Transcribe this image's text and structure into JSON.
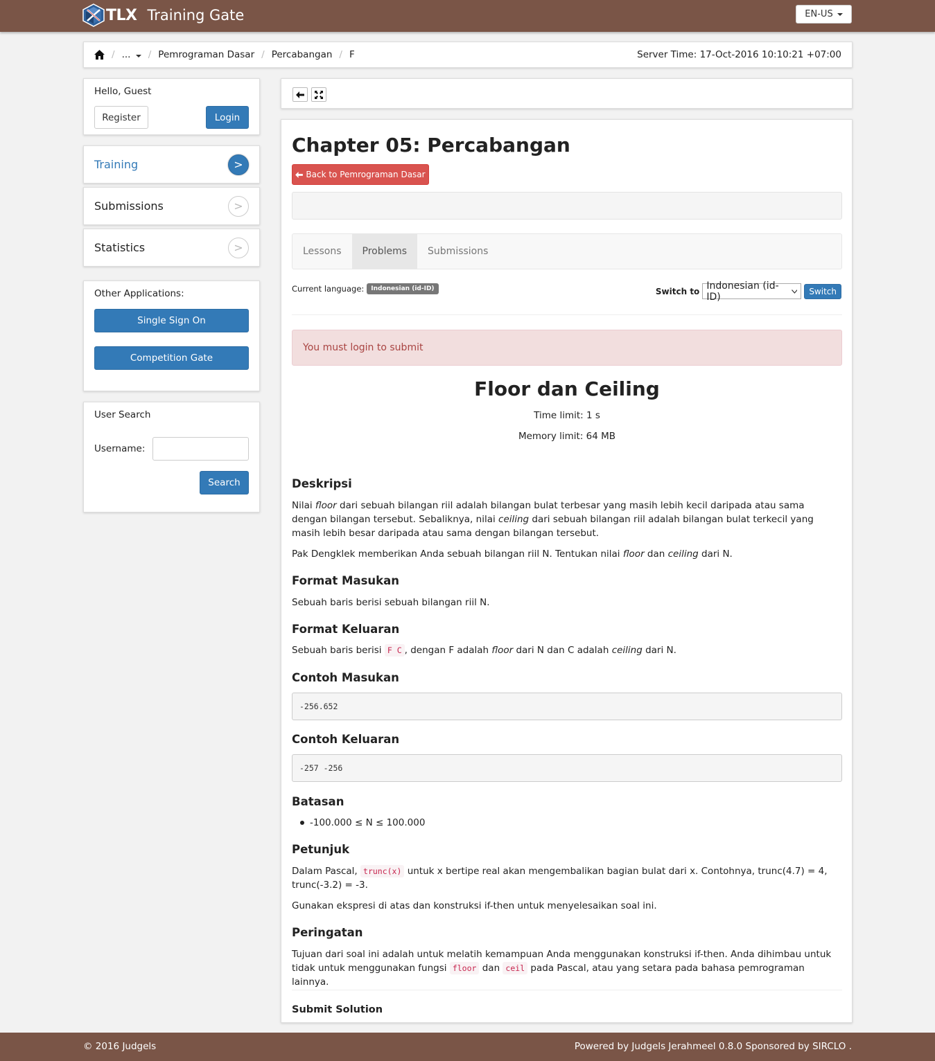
{
  "header": {
    "logo_text": "TLX",
    "app_title": "Training Gate",
    "language": "EN-US",
    "colors": {
      "bar": "#7a5547",
      "primary": "#337ab7",
      "danger": "#d9534f"
    }
  },
  "breadcrumb": {
    "items": [
      "...",
      "Pemrograman Dasar",
      "Percabangan",
      "F"
    ],
    "server_time": "Server Time: 17-Oct-2016 10:10:21 +07:00"
  },
  "user": {
    "greeting": "Hello, Guest",
    "register": "Register",
    "login": "Login"
  },
  "nav": [
    {
      "label": "Training",
      "arrow": ">"
    },
    {
      "label": "Submissions",
      "arrow": ">"
    },
    {
      "label": "Statistics",
      "arrow": ">"
    }
  ],
  "apps": {
    "title": "Other Applications:",
    "sso": "Single Sign On",
    "competition": "Competition Gate"
  },
  "user_search": {
    "title": "User Search",
    "username_label": "Username:",
    "username_value": "",
    "search": "Search"
  },
  "chapter": {
    "title": "Chapter 05: Percabangan",
    "back": "Back to Pemrograman Dasar",
    "tabs": [
      "Lessons",
      "Problems",
      "Submissions"
    ],
    "current_language_label": "Current language:",
    "current_language": "Indonesian (id-ID)",
    "switch_label": "Switch to",
    "switch_value": "Indonesian (id-ID)",
    "switch_button": "Switch",
    "alert": "You must login to submit"
  },
  "problem": {
    "title": "Floor dan Ceiling",
    "time_limit": "Time limit: 1 s",
    "memory_limit": "Memory limit: 64 MB",
    "deskripsi_h": "Deskripsi",
    "d1_a": "Nilai ",
    "d1_floor": "floor",
    "d1_b": " dari sebuah bilangan riil adalah bilangan bulat terbesar yang masih lebih kecil daripada atau sama dengan bilangan tersebut. Sebaliknya, nilai ",
    "d1_ceiling": "ceiling",
    "d1_c": " dari sebuah bilangan riil adalah bilangan bulat terkecil yang masih lebih besar daripada atau sama dengan bilangan tersebut.",
    "d2_a": "Pak Dengklek memberikan Anda sebuah bilangan riil N. Tentukan nilai ",
    "d2_floor": "floor",
    "d2_b": " dan ",
    "d2_ceiling": "ceiling",
    "d2_c": " dari N.",
    "masukan_h": "Format Masukan",
    "masukan": "Sebuah baris berisi sebuah bilangan riil N.",
    "keluaran_h": "Format Keluaran",
    "k_a": "Sebuah baris berisi ",
    "k_code": "F C",
    "k_b": ", dengan F adalah ",
    "k_floor": "floor",
    "k_c": " dari N dan C adalah ",
    "k_ceiling": "ceiling",
    "k_d": " dari N.",
    "contoh_masukan_h": "Contoh Masukan",
    "contoh_masukan": "-256.652",
    "contoh_keluaran_h": "Contoh Keluaran",
    "contoh_keluaran": "-257 -256",
    "batasan_h": "Batasan",
    "batasan": "-100.000 ≤ N ≤ 100.000",
    "petunjuk_h": "Petunjuk",
    "p1_a": "Dalam Pascal, ",
    "p1_code": "trunc(x)",
    "p1_b": " untuk x bertipe real akan mengembalikan bagian bulat dari x. Contohnya, trunc(4.7) = 4, trunc(-3.2) = -3.",
    "p2": "Gunakan ekspresi di atas dan konstruksi if-then untuk menyelesaikan soal ini.",
    "peringatan_h": "Peringatan",
    "w_a": "Tujuan dari soal ini adalah untuk melatih kemampuan Anda menggunakan konstruksi if-then. Anda dihimbau untuk tidak untuk menggunakan fungsi ",
    "w_floor": "floor",
    "w_b": " dan ",
    "w_ceil": "ceil",
    "w_c": " pada Pascal, atau yang setara pada bahasa pemrograman lainnya.",
    "submit_h": "Submit Solution"
  },
  "footer": {
    "left": "© 2016 Judgels",
    "right": "Powered by Judgels Jerahmeel 0.8.0 Sponsored by SIRCLO ."
  }
}
